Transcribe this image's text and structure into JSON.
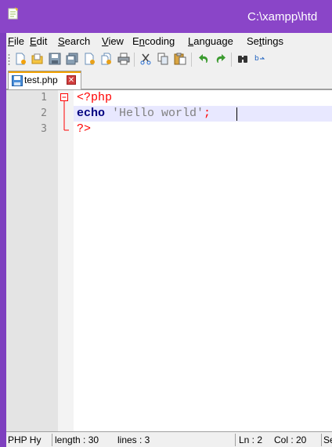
{
  "window": {
    "title": "C:\\xampp\\htd",
    "accent": "#8a45c8"
  },
  "menu": {
    "items": [
      {
        "pre": "",
        "ul": "F",
        "post": "ile"
      },
      {
        "pre": "",
        "ul": "E",
        "post": "dit"
      },
      {
        "pre": "",
        "ul": "S",
        "post": "earch"
      },
      {
        "pre": "",
        "ul": "V",
        "post": "iew"
      },
      {
        "pre": "E",
        "ul": "n",
        "post": "coding"
      },
      {
        "pre": "",
        "ul": "L",
        "post": "anguage"
      },
      {
        "pre": "Se",
        "ul": "t",
        "post": "tings"
      }
    ]
  },
  "toolbar": {
    "icons": [
      "new-file-icon",
      "open-file-icon",
      "save-icon",
      "save-all-icon",
      "close-icon",
      "close-all-icon",
      "print-icon",
      "cut-icon",
      "copy-icon",
      "paste-icon",
      "undo-icon",
      "redo-icon",
      "find-icon",
      "replace-icon"
    ]
  },
  "tab": {
    "label": "test.php",
    "close_label": "✕"
  },
  "editor": {
    "lines": [
      {
        "no": "1",
        "tokens": [
          {
            "t": "<?php",
            "c": "tok-php"
          }
        ]
      },
      {
        "no": "2",
        "tokens": [
          {
            "t": "echo",
            "c": "tok-kw"
          },
          {
            "t": " 'Hello world'",
            "c": "tok-str"
          },
          {
            "t": ";",
            "c": "tok-op"
          }
        ]
      },
      {
        "no": "3",
        "tokens": [
          {
            "t": "?>",
            "c": "tok-php"
          }
        ]
      }
    ]
  },
  "status": {
    "language": "PHP Hy",
    "length": "length : 30",
    "lines": "lines : 3",
    "ln": "Ln : 2",
    "col": "Col : 20",
    "sel": "Se"
  }
}
